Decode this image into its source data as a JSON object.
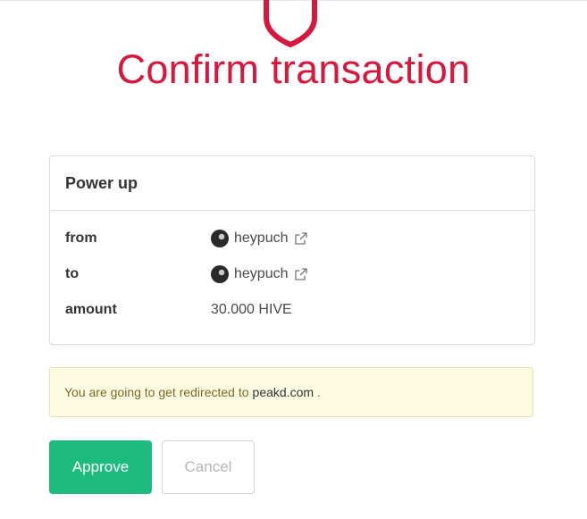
{
  "header": {
    "title": "Confirm transaction",
    "logo_icon": "shield-icon",
    "accent_color": "#d9163b"
  },
  "operation": {
    "title": "Power up",
    "rows": [
      {
        "label": "from",
        "value": "heypuch",
        "has_avatar": true,
        "has_link_icon": true
      },
      {
        "label": "to",
        "value": "heypuch",
        "has_avatar": true,
        "has_link_icon": true
      },
      {
        "label": "amount",
        "value": "30.000 HIVE",
        "has_avatar": false,
        "has_link_icon": false
      }
    ]
  },
  "notice": {
    "text": "You are going to get redirected to",
    "domain": "peakd.com",
    "suffix": "."
  },
  "actions": {
    "approve_label": "Approve",
    "cancel_label": "Cancel",
    "approve_color": "#1dbb7e"
  }
}
